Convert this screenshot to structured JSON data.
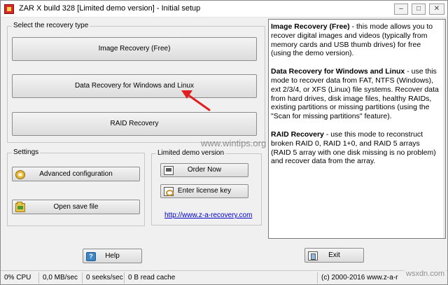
{
  "window": {
    "title": "ZAR X build 328 [Limited demo version] - Initial setup",
    "controls": {
      "minimize": "–",
      "maximize": "□",
      "close": "✕"
    }
  },
  "recovery_group": {
    "label": "Select the recovery type",
    "buttons": [
      {
        "label": "Image Recovery (Free)"
      },
      {
        "label": "Data Recovery for Windows and Linux"
      },
      {
        "label": "RAID Recovery"
      }
    ]
  },
  "settings_group": {
    "label": "Settings",
    "advanced_label": "Advanced configuration",
    "open_save_label": "Open save file"
  },
  "demo_group": {
    "label": "Limited demo version",
    "order_label": "Order Now",
    "license_label": "Enter license key",
    "link": "http://www.z-a-recovery.com"
  },
  "info": {
    "paragraphs": [
      {
        "title": "Image Recovery (Free)",
        "body": " - this mode allows you to recover digital images and videos (typically from memory cards and USB thumb drives) for free (using the demo version)."
      },
      {
        "title": "Data Recovery for Windows and Linux",
        "body": " - use this mode to recover data from FAT, NTFS (Windows), ext 2/3/4, or XFS (Linux) file systems. Recover data from hard drives, disk image files, healthy RAIDs, existing partitions or missing partitions (using the \"Scan for missing partitions\" feature)."
      },
      {
        "title": "RAID Recovery",
        "body": " - use this mode to reconstruct broken RAID 0, RAID 1+0, and RAID 5 arrays (RAID 5 array with one disk missing is no problem) and recover data from the array."
      }
    ]
  },
  "footer": {
    "help_label": "Help",
    "exit_label": "Exit"
  },
  "status": {
    "cpu": "0% CPU",
    "throughput": "0,0 MB/sec",
    "seeks": "0 seeks/sec",
    "read_cache": "0 B read cache",
    "copyright": "(c) 2000-2016 www.z-a-r"
  },
  "watermarks": {
    "center": "www.wintips.org",
    "corner": "wsxdn.com"
  },
  "colors": {
    "annotation_arrow": "#e02020",
    "link": "#0000cc"
  },
  "icons": {
    "advanced": "gear-icon",
    "open_save": "folder-icon",
    "order": "cart-icon",
    "license": "key-icon",
    "help": "help-icon",
    "exit": "exit-icon"
  }
}
